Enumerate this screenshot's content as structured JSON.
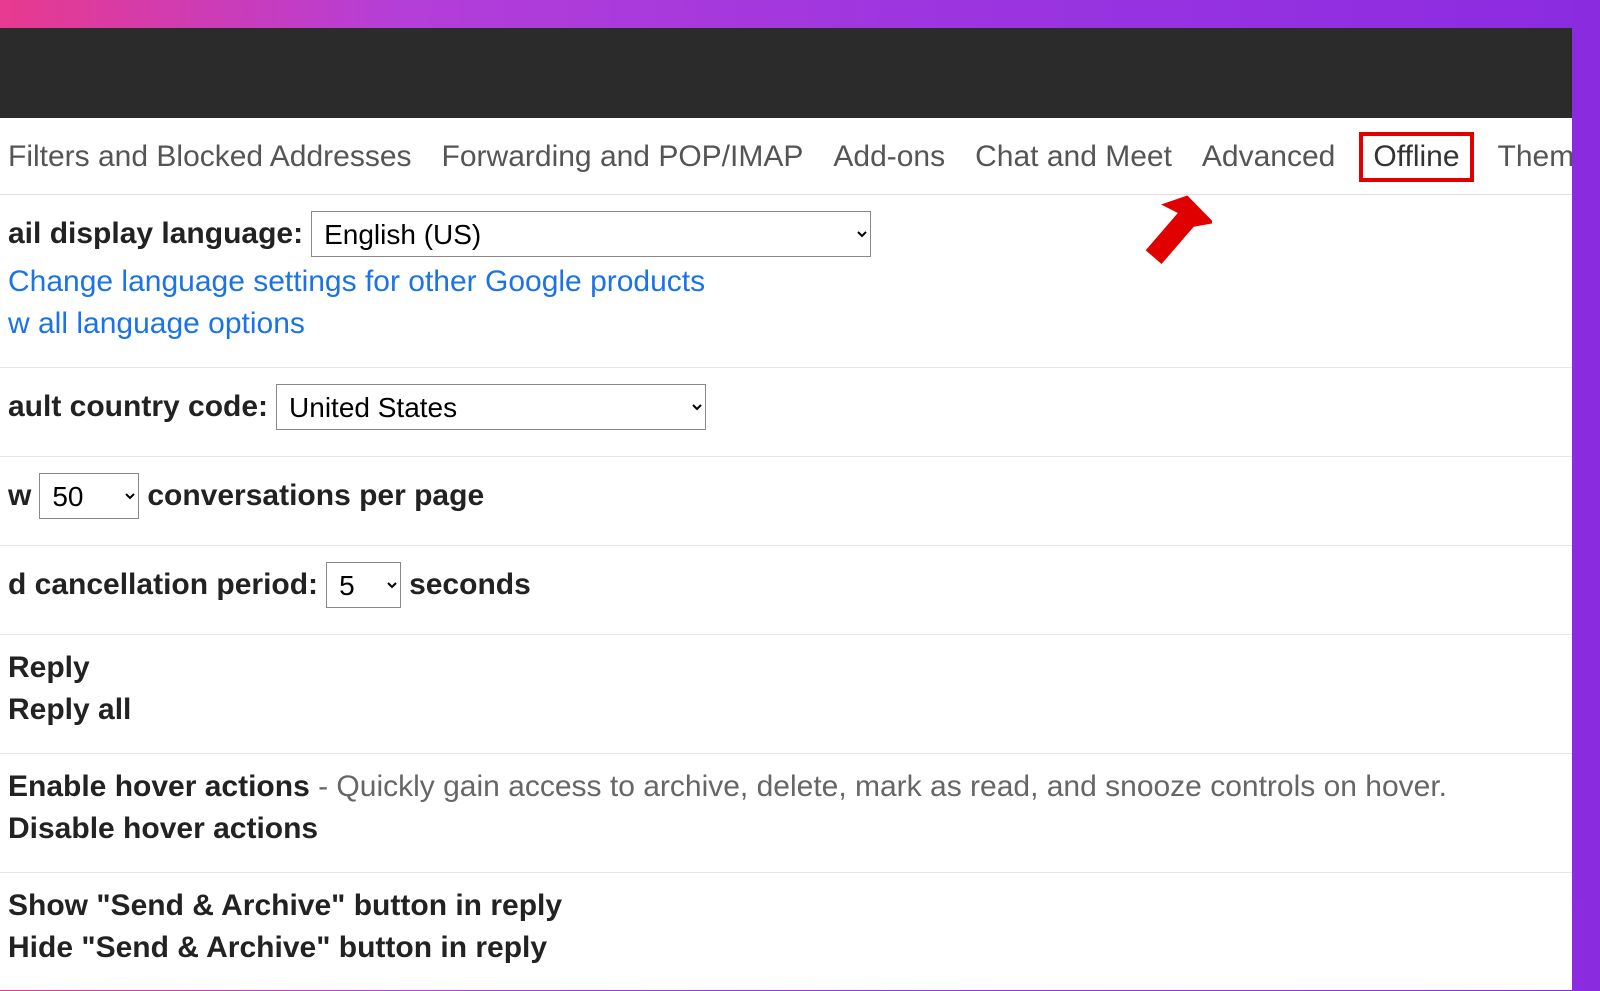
{
  "tabs": {
    "filters": "Filters and Blocked Addresses",
    "forwarding": "Forwarding and POP/IMAP",
    "addons": "Add-ons",
    "chat": "Chat and Meet",
    "advanced": "Advanced",
    "offline": "Offline",
    "themes": "Themes"
  },
  "language": {
    "label_fragment": "ail display language:",
    "selected": "English (US)",
    "change_link": "Change language settings for other Google products",
    "show_all_fragment": "w all language options"
  },
  "country": {
    "label_fragment": "ault country code:",
    "selected": "United States"
  },
  "pagesize": {
    "prefix_fragment": "w",
    "value": "50",
    "suffix": "conversations per page"
  },
  "undo": {
    "label_fragment": "d cancellation period:",
    "value": "5",
    "suffix": "seconds"
  },
  "reply": {
    "option1": "Reply",
    "option2": "Reply all"
  },
  "hover": {
    "enable_label": "Enable hover actions",
    "enable_desc": " - Quickly gain access to archive, delete, mark as read, and snooze controls on hover.",
    "disable_label": "Disable hover actions"
  },
  "send_archive": {
    "show": "Show \"Send & Archive\" button in reply",
    "hide": "Hide \"Send & Archive\" button in reply"
  }
}
